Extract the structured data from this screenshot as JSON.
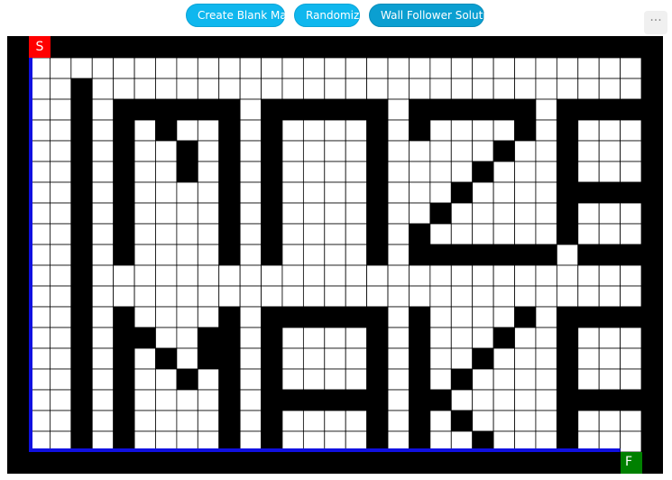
{
  "toolbar": {
    "create_blank_label": "Create Blank Maze",
    "randomize_label": "Randomize",
    "wall_follower_label": "Wall Follower Solution",
    "menu_label": "···"
  },
  "maze": {
    "cols": 29,
    "rows": 19,
    "grid": [
      "..S..........................",
      "..#.........................",
      "..#.######.######.######.######...",
      "..#.#.#..#.#....#.#....#.#........",
      "..#.#..#.#.#....#.....#..#........",
      "..#.#..#.#.#....#....#...#........",
      "..#.#....#.#....#...#....######...",
      "..#.#....#.#....#..#.....#........",
      "..#.#....#.#....#.#......#........",
      "..#.#....#.#....#.#######.######..",
      "..#..........................",
      "..#..........................",
      "..#.#....#.######.#....#.######..",
      "..#.##..##.#....#.#...#..#....#..",
      "..#.#.#.##.#....#.#..#...#....#..",
      "..#.#..#.#.#....#.#.#....#....#..",
      "..#.#....#.######.##.....######..",
      "..#.#....#.#....#.#.#....#...#...",
      "..#.#....#.#....#.#..#...#....#..."
    ],
    "start_label": "S",
    "finish_label": "F",
    "colors": {
      "wall": "#000000",
      "cell": "#ffffff",
      "grid_line": "#000000",
      "path": "#1010e0",
      "start": "#ff0000",
      "finish": "#008000"
    }
  }
}
